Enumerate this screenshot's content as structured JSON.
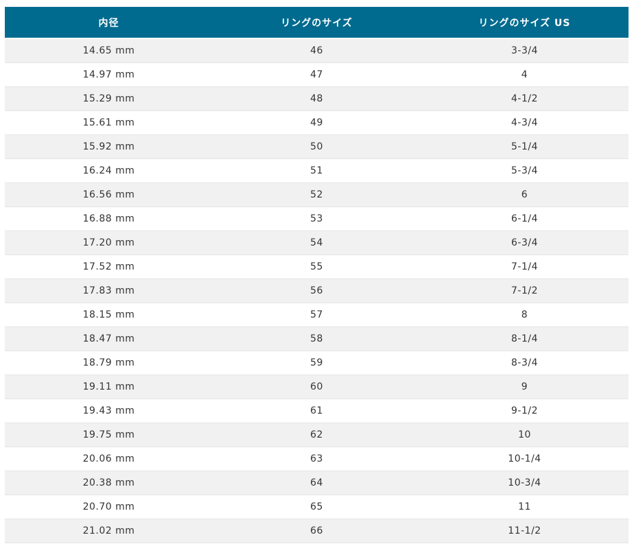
{
  "table": {
    "headers": [
      "内径",
      "リングのサイズ",
      "リングのサイズ US"
    ],
    "rows": [
      [
        "14.65 mm",
        "46",
        "3-3/4"
      ],
      [
        "14.97 mm",
        "47",
        "4"
      ],
      [
        "15.29 mm",
        "48",
        "4-1/2"
      ],
      [
        "15.61 mm",
        "49",
        "4-3/4"
      ],
      [
        "15.92 mm",
        "50",
        "5-1/4"
      ],
      [
        "16.24 mm",
        "51",
        "5-3/4"
      ],
      [
        "16.56 mm",
        "52",
        "6"
      ],
      [
        "16.88 mm",
        "53",
        "6-1/4"
      ],
      [
        "17.20 mm",
        "54",
        "6-3/4"
      ],
      [
        "17.52 mm",
        "55",
        "7-1/4"
      ],
      [
        "17.83 mm",
        "56",
        "7-1/2"
      ],
      [
        "18.15 mm",
        "57",
        "8"
      ],
      [
        "18.47 mm",
        "58",
        "8-1/4"
      ],
      [
        "18.79 mm",
        "59",
        "8-3/4"
      ],
      [
        "19.11 mm",
        "60",
        "9"
      ],
      [
        "19.43 mm",
        "61",
        "9-1/2"
      ],
      [
        "19.75 mm",
        "62",
        "10"
      ],
      [
        "20.06 mm",
        "63",
        "10-1/4"
      ],
      [
        "20.38 mm",
        "64",
        "10-3/4"
      ],
      [
        "20.70 mm",
        "65",
        "11"
      ],
      [
        "21.02 mm",
        "66",
        "11-1/2"
      ]
    ]
  },
  "colors": {
    "header_bg": "#006b8f",
    "header_text": "#ffffff",
    "row_odd_bg": "#f1f1f1",
    "row_even_bg": "#ffffff",
    "cell_text": "#333333"
  }
}
